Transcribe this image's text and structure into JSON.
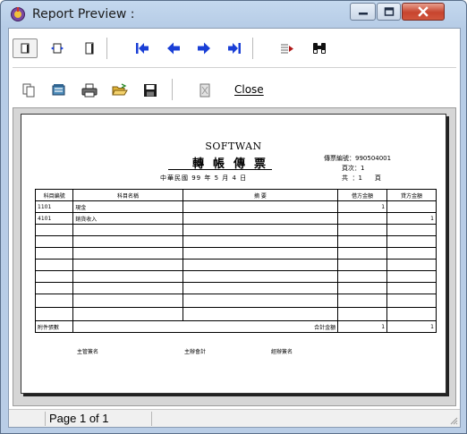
{
  "window": {
    "title": "Report Preview :"
  },
  "toolbar2": {
    "close_label": "Close"
  },
  "report": {
    "company": "SOFTWAN",
    "title": "轉帳傳票",
    "date_line": "中華民國  99  年  5   月  4  日",
    "voucher_no_label": "傳票編號：",
    "voucher_no": "990504001",
    "page_label": "頁次：",
    "page_no": "1",
    "total_label": "共  ：",
    "total_pages": "1",
    "total_unit": "頁",
    "columns": [
      "科目編號",
      "科目名稱",
      "摘    要",
      "借方金額",
      "貸方金額"
    ],
    "rows": [
      {
        "code": "1101",
        "name": "現金",
        "memo": "",
        "debit": "1",
        "credit": ""
      },
      {
        "code": "4101",
        "name": "銷貨收入",
        "memo": "",
        "debit": "",
        "credit": "1"
      }
    ],
    "footer_left": "附件張數",
    "footer_total_label": "合計金額",
    "footer_debit": "1",
    "footer_credit": "1",
    "signatures": [
      "主管簽名",
      "主辦會計",
      "經辦簽名"
    ]
  },
  "status": {
    "page_text": "Page 1 of 1"
  }
}
